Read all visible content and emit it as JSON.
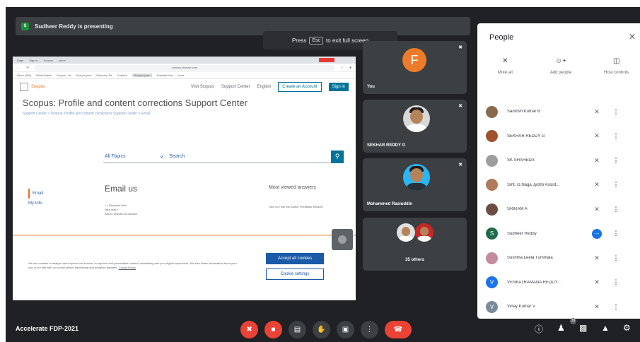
{
  "banner": {
    "initial": "S",
    "text": "Sudheer Reddy is presenting"
  },
  "esc_hint": {
    "press": "Press",
    "key": "Esc",
    "suffix": "to exit full screen"
  },
  "shared_screen": {
    "browser_tabs": [
      "Edge",
      "Sign in",
      "Scopus",
      "Inbox"
    ],
    "url": "service.elsevier.com",
    "bookmarks": [
      "Inbox (384)",
      "PhotoGrade",
      "Scopus - Ar",
      "Scopus pow",
      "Windows Re",
      "Content",
      "Scopus pow",
      "Scalable Hm",
      "more"
    ],
    "brand": "Scopus",
    "nav_links": [
      "Visit Scopus",
      "Support Center",
      "English"
    ],
    "create_account": "Create an Account",
    "sign_in": "Sign in",
    "title": "Scopus: Profile and content corrections Support Center",
    "breadcrumb": "Support Center > Scopus: Profile and content corrections Support Center > Email",
    "search_topic": "All Topics",
    "search_placeholder": "Search",
    "side_links": [
      "Email",
      "My Info"
    ],
    "email_heading": "Email us",
    "required": "* = Required field",
    "form_hint": "New task *",
    "form_options": "Add to selected & discuss",
    "most_viewed": "Most viewed answers",
    "most_viewed_item": "How do I use the Author Feedback Wizard?",
    "cookie_text": "We use cookies to analyze and improve our service, to improve and personalize content, advertising and your digital experience. We also share information about your use of our site with our social media, advertising and analytics partners.",
    "cookie_link": "Cookie Policy",
    "accept_all": "Accept all cookies",
    "cookie_settings": "Cookie settings"
  },
  "tiles": [
    {
      "name": "You",
      "initial": "F"
    },
    {
      "name": "SEKHAR REDDY G"
    },
    {
      "name": "Mohammed Rasiuddin"
    },
    {
      "name": "35 others"
    }
  ],
  "people_panel": {
    "title": "People",
    "actions": [
      {
        "label": "Mute all",
        "icon": "mic-off-icon"
      },
      {
        "label": "Add people",
        "icon": "person-add-icon"
      },
      {
        "label": "Host controls",
        "icon": "toggle-icon"
      }
    ],
    "participants": [
      {
        "name": "Santosh Kumar B",
        "color": "#8a6a4f"
      },
      {
        "name": "SEKHAR REDDY G",
        "color": "#a0522d"
      },
      {
        "name": "SK SHAHEDA",
        "color": "#9e9e9e"
      },
      {
        "name": "Smt. G.Naga Jyothi Assist...",
        "color": "#b07a5a"
      },
      {
        "name": "SRIRAM A",
        "color": "#6d4c41"
      },
      {
        "name": "Sudheer Reddy",
        "initial": "S",
        "color": "#1e6b4a",
        "speaking": true
      },
      {
        "name": "Sushma Leela Tummala",
        "color": "#c48a9e"
      },
      {
        "name": "VENKATRAMANA REDDY...",
        "initial": "V",
        "color": "#1a73e8"
      },
      {
        "name": "Vinay Kumar V",
        "initial": "V",
        "color": "#7a8a9a"
      }
    ]
  },
  "meeting_name": "Accelerate FDP-2021",
  "participant_count": "39"
}
